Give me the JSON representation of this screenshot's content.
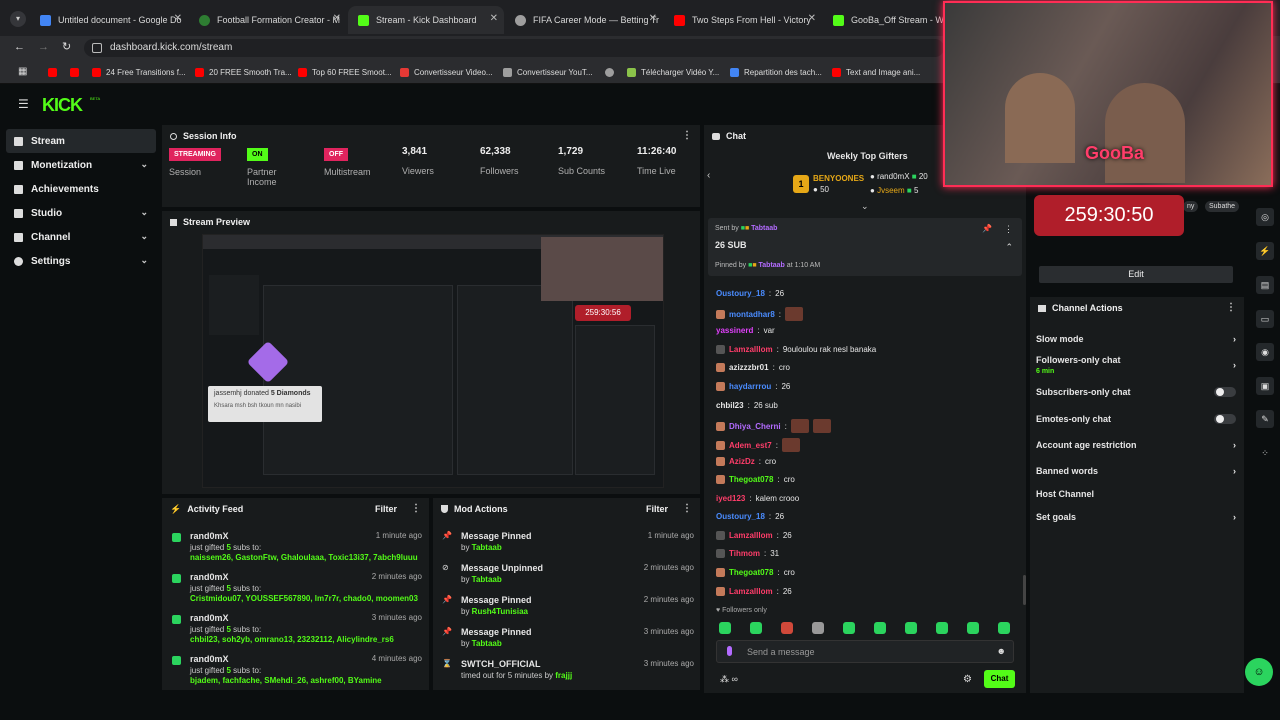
{
  "browser": {
    "tabs": [
      {
        "label": "Untitled document - Google Do",
        "color": "#4285f4"
      },
      {
        "label": "Football Formation Creator - M",
        "color": "#2e7d32"
      },
      {
        "label": "Stream - Kick Dashboard",
        "color": "#53fc18"
      },
      {
        "label": "FIFA Career Mode — Betting Tr",
        "color": "#9e9e9e"
      },
      {
        "label": "Two Steps From Hell - Victory",
        "color": "#ff0000"
      },
      {
        "label": "GooBa_Off Stream - Watch",
        "color": "#53fc18"
      }
    ],
    "url": "dashboard.kick.com/stream",
    "bookmarks": [
      {
        "label": "",
        "color": "#ff0000"
      },
      {
        "label": "",
        "color": "#ff0000"
      },
      {
        "label": "24 Free Transitions f...",
        "color": "#ff0000"
      },
      {
        "label": "20 FREE Smooth Tra...",
        "color": "#ff0000"
      },
      {
        "label": "Top 60 FREE Smoot...",
        "color": "#ff0000"
      },
      {
        "label": "Convertisseur Video...",
        "color": "#e53935"
      },
      {
        "label": "Convertisseur YouT...",
        "color": "#9e9e9e"
      },
      {
        "label": "",
        "color": "#9e9e9e"
      },
      {
        "label": "Télécharger Vidéo Y...",
        "color": "#8bc34a"
      },
      {
        "label": "Repartition des tach...",
        "color": "#4285f4"
      },
      {
        "label": "Text and Image ani...",
        "color": "#ff0000"
      }
    ]
  },
  "brand": {
    "logo": "KICK",
    "beta": "BETA",
    "accent": "#53fc18"
  },
  "sidebar": {
    "items": [
      {
        "label": "Stream",
        "icon": "stream-icon"
      },
      {
        "label": "Monetization",
        "icon": "monetization-icon"
      },
      {
        "label": "Achievements",
        "icon": "trophy-icon"
      },
      {
        "label": "Studio",
        "icon": "studio-icon"
      },
      {
        "label": "Channel",
        "icon": "channel-icon"
      },
      {
        "label": "Settings",
        "icon": "gear-icon"
      }
    ]
  },
  "session": {
    "title": "Session Info",
    "streaming_badge": "STREAMING",
    "session_label": "Session",
    "partner_badge": "ON",
    "partner_label": "Partner Income",
    "multistream_badge": "OFF",
    "multistream_label": "Multistream",
    "viewers": "3,841",
    "viewers_label": "Viewers",
    "followers": "62,338",
    "followers_label": "Followers",
    "subs": "1,729",
    "subs_label": "Sub Counts",
    "time": "11:26:40",
    "time_label": "Time Live"
  },
  "preview": {
    "title": "Stream Preview",
    "donation_user": "jassemhj",
    "donation_text": "donated",
    "donation_amount": "5 Diamonds",
    "donation_message": "Khsara msh bsh tkoun mn nasibi",
    "timer": "259:30:56"
  },
  "activity": {
    "title": "Activity Feed",
    "filter": "Filter",
    "items": [
      {
        "user": "rand0mX",
        "time": "1 minute ago",
        "pre": "just gifted ",
        "count": "5",
        "post": " subs to:",
        "recipients": "naissem26, GastonFtw, Ghaloulaaa, Toxic13i37, 7abch9luuu"
      },
      {
        "user": "rand0mX",
        "time": "2 minutes ago",
        "pre": "just gifted ",
        "count": "5",
        "post": " subs to:",
        "recipients": "Cristmidou07, YOUSSEF567890, lm7r7r, chado0, moomen03"
      },
      {
        "user": "rand0mX",
        "time": "3 minutes ago",
        "pre": "just gifted ",
        "count": "5",
        "post": " subs to:",
        "recipients": "chbil23, soh2yb, omrano13, 23232112, Alicylindre_rs6"
      },
      {
        "user": "rand0mX",
        "time": "4 minutes ago",
        "pre": "just gifted ",
        "count": "5",
        "post": " subs to:",
        "recipients": "bjadem, fachfache, SMehdi_26, ashref00, BYamine"
      }
    ]
  },
  "mod": {
    "title": "Mod Actions",
    "filter": "Filter",
    "items": [
      {
        "action": "Message Pinned",
        "by": "by ",
        "user": "Tabtaab",
        "time": "1 minute ago",
        "icon": "pin-icon"
      },
      {
        "action": "Message Unpinned",
        "by": "by ",
        "user": "Tabtaab",
        "time": "2 minutes ago",
        "icon": "unpin-icon"
      },
      {
        "action": "Message Pinned",
        "by": "by ",
        "user": "Rush4Tunisiaa",
        "time": "2 minutes ago",
        "icon": "pin-icon"
      },
      {
        "action": "Message Pinned",
        "by": "by ",
        "user": "Tabtaab",
        "time": "3 minutes ago",
        "icon": "pin-icon"
      },
      {
        "action": "SWTCH_OFFICIAL",
        "by": "timed out for 5 minutes by ",
        "user": "frajjj",
        "time": "3 minutes ago",
        "icon": "hourglass-icon"
      }
    ]
  },
  "chat": {
    "title": "Chat",
    "gifters_title": "Weekly Top Gifters",
    "gifters": [
      {
        "rank": "1",
        "name": "BENYOONES",
        "count": "50"
      },
      {
        "name": "rand0mX",
        "count": "20"
      },
      {
        "name": "Jvseem",
        "count": "5"
      }
    ],
    "pinned": {
      "sent_by": "Sent by",
      "sender": "Tabtaab",
      "message": "26 SUB",
      "pinned_by": "Pinned by",
      "pinner": "Tabtaab",
      "at": "at 1:10 AM"
    },
    "messages": [
      {
        "user": "Oustoury_18",
        "color": "#4a8cff",
        "text": "26"
      },
      {
        "user": "montadhar8",
        "color": "#4a8cff",
        "text": ""
      },
      {
        "user": "yassinerd",
        "color": "#e040fb",
        "text": "var"
      },
      {
        "user": "Lamzalllom",
        "color": "#ff3d6a",
        "text": "9ouloulou rak nesl banaka"
      },
      {
        "user": "azizzzbr01",
        "color": "#e6e6e6",
        "text": "cro"
      },
      {
        "user": "haydarrrou",
        "color": "#4a8cff",
        "text": "26"
      },
      {
        "user": "chbil23",
        "color": "#e6e6e6",
        "text": "26 sub"
      },
      {
        "user": "Dhiya_Cherni",
        "color": "#b36bff",
        "text": ""
      },
      {
        "user": "Adem_est7",
        "color": "#ff3d6a",
        "text": ""
      },
      {
        "user": "AzizDz",
        "color": "#ff3d6a",
        "text": "cro"
      },
      {
        "user": "Thegoat078",
        "color": "#53fc18",
        "text": "cro"
      },
      {
        "user": "iyed123",
        "color": "#ff3d6a",
        "text": "kalem crooo"
      },
      {
        "user": "Oustoury_18",
        "color": "#4a8cff",
        "text": "26"
      },
      {
        "user": "Lamzalllom",
        "color": "#ff3d6a",
        "text": "26"
      },
      {
        "user": "Tihmom",
        "color": "#ff3d6a",
        "text": "31"
      },
      {
        "user": "Thegoat078",
        "color": "#53fc18",
        "text": "cro"
      },
      {
        "user": "Lamzalllom",
        "color": "#ff3d6a",
        "text": "26"
      }
    ],
    "followers_only": "Followers only",
    "input_placeholder": "Send a message",
    "chat_button": "Chat"
  },
  "overlay": {
    "cam_label": "GooBa",
    "timer": "259:30:50",
    "edit": "Edit",
    "pill": "Subathe",
    "pill2": "ny"
  },
  "channel_actions": {
    "title": "Channel Actions",
    "items": [
      {
        "label": "Slow mode",
        "kind": "chevron"
      },
      {
        "label": "Followers-only chat",
        "sub": "6 min",
        "kind": "chevron"
      },
      {
        "label": "Subscribers-only chat",
        "kind": "toggle"
      },
      {
        "label": "Emotes-only chat",
        "kind": "toggle"
      },
      {
        "label": "Account age restriction",
        "kind": "chevron"
      },
      {
        "label": "Banned words",
        "kind": "chevron"
      },
      {
        "label": "Host Channel",
        "kind": "none"
      },
      {
        "label": "Set goals",
        "kind": "chevron"
      }
    ]
  }
}
